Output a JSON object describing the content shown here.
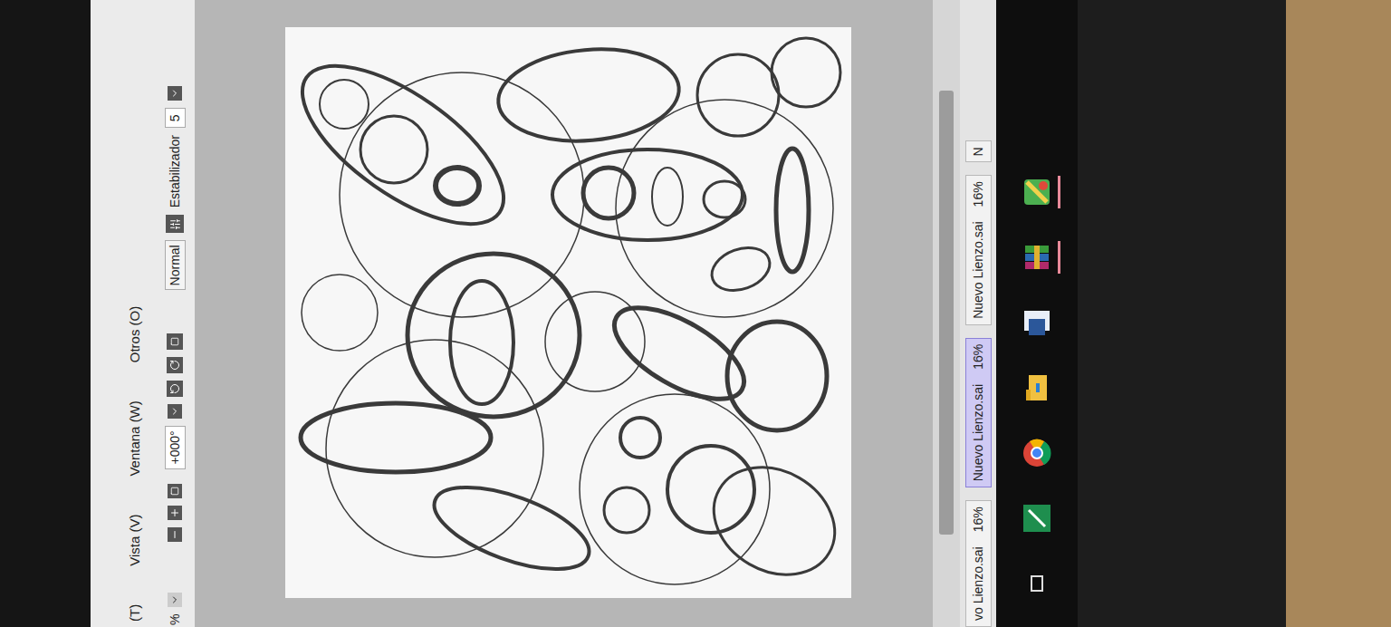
{
  "menu": [
    "(T)",
    "Vista (V)",
    "Ventana (W)",
    "Otros (O)"
  ],
  "toolbar": {
    "zoom": "%",
    "angle": "+000°",
    "blend": "Normal",
    "stabilizer_label": "Estabilizador",
    "stabilizer_value": "5"
  },
  "tabs": [
    {
      "label": "vo Lienzo.sai",
      "zoom": "16%",
      "selected": false
    },
    {
      "label": "Nuevo Lienzo.sai",
      "zoom": "16%",
      "selected": true
    },
    {
      "label": "Nuevo Lienzo.sai",
      "zoom": "16%",
      "selected": false
    },
    {
      "label": "N",
      "selected": false
    }
  ],
  "taskbar": [
    {
      "kind": "taskview",
      "running": false
    },
    {
      "kind": "green",
      "running": false
    },
    {
      "kind": "chrome",
      "running": false
    },
    {
      "kind": "explorer",
      "running": false
    },
    {
      "kind": "word",
      "running": false
    },
    {
      "kind": "winrar",
      "running": true
    },
    {
      "kind": "sai",
      "running": true
    }
  ]
}
